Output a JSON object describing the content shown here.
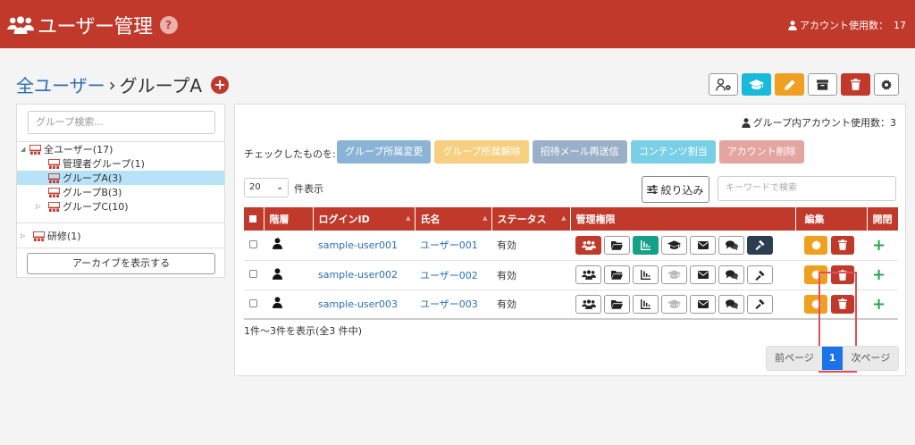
{
  "header": {
    "title": "ユーザー管理",
    "help": "?",
    "account_label": "アカウント使用数：",
    "account_count": "17"
  },
  "breadcrumb": {
    "root": "全ユーザー",
    "sep": "›",
    "current": "グループA",
    "add": "+"
  },
  "sidebar": {
    "search_placeholder": "グループ検索...",
    "tree": [
      {
        "label": "全ユーザー(17)",
        "toggle": "◢",
        "selected": false
      },
      {
        "label": "管理者グループ(1)",
        "toggle": "",
        "selected": false
      },
      {
        "label": "グループA(3)",
        "toggle": "",
        "selected": true
      },
      {
        "label": "グループB(3)",
        "toggle": "",
        "selected": false
      },
      {
        "label": "グループC(10)",
        "toggle": "▷",
        "selected": false
      }
    ],
    "training": {
      "label": "研修(1)",
      "toggle": "▷"
    },
    "archive_button": "アーカイブを表示する"
  },
  "content": {
    "group_usage": "グループ内アカウント使用数：3",
    "checked_label": "チェックしたものを:",
    "actions": [
      {
        "label": "グループ所属変更",
        "color": "#8ab4d6"
      },
      {
        "label": "グループ所属解除",
        "color": "#f6d080"
      },
      {
        "label": "招待メール再送信",
        "color": "#9ab0c8"
      },
      {
        "label": "コンテンツ割当",
        "color": "#79cfe6"
      },
      {
        "label": "アカウント削除",
        "color": "#e4a4a0"
      }
    ],
    "per_page": "20",
    "per_page_arrow": "⌄",
    "per_page_label": "件表示",
    "filter_label": "絞り込み",
    "keyword_placeholder": "キーワードで検索",
    "columns": {
      "level": "階層",
      "login_id": "ログインID",
      "name": "氏名",
      "status": "ステータス",
      "perms": "管理権限",
      "edit": "編集",
      "open": "開閉"
    },
    "rows": [
      {
        "login_id": "sample-user001",
        "name": "ユーザー001",
        "status": "有効",
        "open": "+"
      },
      {
        "login_id": "sample-user002",
        "name": "ユーザー002",
        "status": "有効",
        "open": "+"
      },
      {
        "login_id": "sample-user003",
        "name": "ユーザー003",
        "status": "有効",
        "open": "+"
      }
    ],
    "count_text": "1件〜3件を表示(全3 件中)",
    "pager": {
      "prev": "前ページ",
      "current": "1",
      "next": "次ページ"
    }
  },
  "colors": {
    "brand": "#c0392b",
    "link": "#2a6fb0",
    "accent_blue": "#1a73e8",
    "green": "#27a845"
  }
}
